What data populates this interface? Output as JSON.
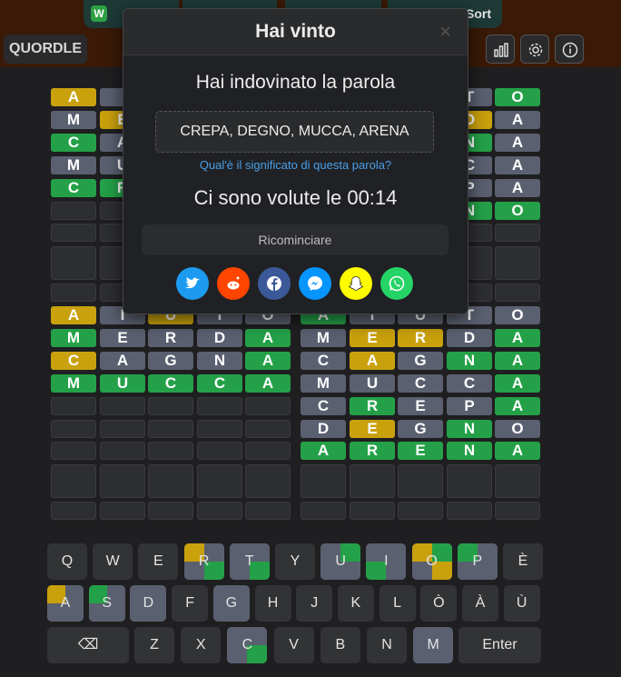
{
  "tabs": [
    {
      "label": "W",
      "text": "",
      "visible_text": ""
    },
    {
      "label": "Sort"
    }
  ],
  "header": {
    "brand": "QUORDLE"
  },
  "modal": {
    "title": "Hai vinto",
    "close": "×",
    "subtitle": "Hai indovinato la parola",
    "answers": "CREPA, DEGNO, MUCCA, ARENA",
    "meaning_link": "Qual'è il significato di questa parola?",
    "time_text": "Ci sono volute le 00:14",
    "restart": "Ricominciare"
  },
  "boards": [
    {
      "rows": [
        {
          "letters": [
            "A",
            "",
            "",
            "",
            ""
          ],
          "states": [
            "y",
            "x",
            "x",
            "x",
            "x"
          ]
        },
        {
          "letters": [
            "M",
            "E",
            "",
            "",
            ""
          ],
          "states": [
            "x",
            "y",
            "x",
            "x",
            "x"
          ]
        },
        {
          "letters": [
            "C",
            "A",
            "",
            "",
            ""
          ],
          "states": [
            "g",
            "x",
            "x",
            "x",
            "x"
          ]
        },
        {
          "letters": [
            "M",
            "U",
            "",
            "",
            ""
          ],
          "states": [
            "x",
            "x",
            "x",
            "x",
            "x"
          ]
        },
        {
          "letters": [
            "C",
            "R",
            "",
            "",
            ""
          ],
          "states": [
            "g",
            "g",
            "x",
            "x",
            "x"
          ]
        }
      ]
    },
    {
      "rows": [
        {
          "letters": [
            "",
            "",
            "",
            "T",
            "O"
          ],
          "states": [
            "x",
            "x",
            "x",
            "x",
            "g"
          ]
        },
        {
          "letters": [
            "",
            "",
            "",
            "D",
            "A"
          ],
          "states": [
            "x",
            "x",
            "x",
            "y",
            "x"
          ]
        },
        {
          "letters": [
            "",
            "",
            "",
            "N",
            "A"
          ],
          "states": [
            "x",
            "x",
            "x",
            "g",
            "x"
          ]
        },
        {
          "letters": [
            "",
            "",
            "",
            "C",
            "A"
          ],
          "states": [
            "x",
            "x",
            "x",
            "x",
            "x"
          ]
        },
        {
          "letters": [
            "",
            "",
            "",
            "P",
            "A"
          ],
          "states": [
            "x",
            "x",
            "x",
            "x",
            "x"
          ]
        },
        {
          "letters": [
            "",
            "",
            "",
            "N",
            "O"
          ],
          "states": [
            "x",
            "x",
            "x",
            "g",
            "g"
          ]
        }
      ]
    },
    {
      "rows": [
        {
          "letters": [
            "A",
            "I",
            "U",
            "T",
            "O"
          ],
          "states": [
            "y",
            "x",
            "y",
            "x",
            "x"
          ]
        },
        {
          "letters": [
            "M",
            "E",
            "R",
            "D",
            "A"
          ],
          "states": [
            "g",
            "x",
            "x",
            "x",
            "g"
          ]
        },
        {
          "letters": [
            "C",
            "A",
            "G",
            "N",
            "A"
          ],
          "states": [
            "y",
            "x",
            "x",
            "x",
            "g"
          ]
        },
        {
          "letters": [
            "M",
            "U",
            "C",
            "C",
            "A"
          ],
          "states": [
            "g",
            "g",
            "g",
            "g",
            "g"
          ]
        }
      ]
    },
    {
      "rows": [
        {
          "letters": [
            "A",
            "I",
            "U",
            "T",
            "O"
          ],
          "states": [
            "g",
            "x",
            "x",
            "x",
            "x"
          ]
        },
        {
          "letters": [
            "M",
            "E",
            "R",
            "D",
            "A"
          ],
          "states": [
            "x",
            "y",
            "y",
            "x",
            "g"
          ]
        },
        {
          "letters": [
            "C",
            "A",
            "G",
            "N",
            "A"
          ],
          "states": [
            "x",
            "y",
            "x",
            "g",
            "g"
          ]
        },
        {
          "letters": [
            "M",
            "U",
            "C",
            "C",
            "A"
          ],
          "states": [
            "x",
            "x",
            "x",
            "x",
            "g"
          ]
        },
        {
          "letters": [
            "C",
            "R",
            "E",
            "P",
            "A"
          ],
          "states": [
            "x",
            "g",
            "x",
            "x",
            "g"
          ]
        },
        {
          "letters": [
            "D",
            "E",
            "G",
            "N",
            "O"
          ],
          "states": [
            "x",
            "y",
            "x",
            "g",
            "x"
          ]
        },
        {
          "letters": [
            "A",
            "R",
            "E",
            "N",
            "A"
          ],
          "states": [
            "g",
            "g",
            "g",
            "g",
            "g"
          ]
        }
      ]
    }
  ],
  "keyboard": {
    "row1": [
      "Q",
      "W",
      "E",
      "R",
      "T",
      "Y",
      "U",
      "I",
      "O",
      "P",
      "È"
    ],
    "row2": [
      "A",
      "S",
      "D",
      "F",
      "G",
      "H",
      "J",
      "K",
      "L",
      "Ò",
      "À",
      "Ù"
    ],
    "row3": [
      "⌫",
      "Z",
      "X",
      "C",
      "V",
      "B",
      "N",
      "M",
      "Enter"
    ]
  },
  "colors": {
    "green": "#24a148",
    "yellow": "#c9a10d",
    "gray": "#5a6070",
    "brand_bg": "#3a1906"
  }
}
